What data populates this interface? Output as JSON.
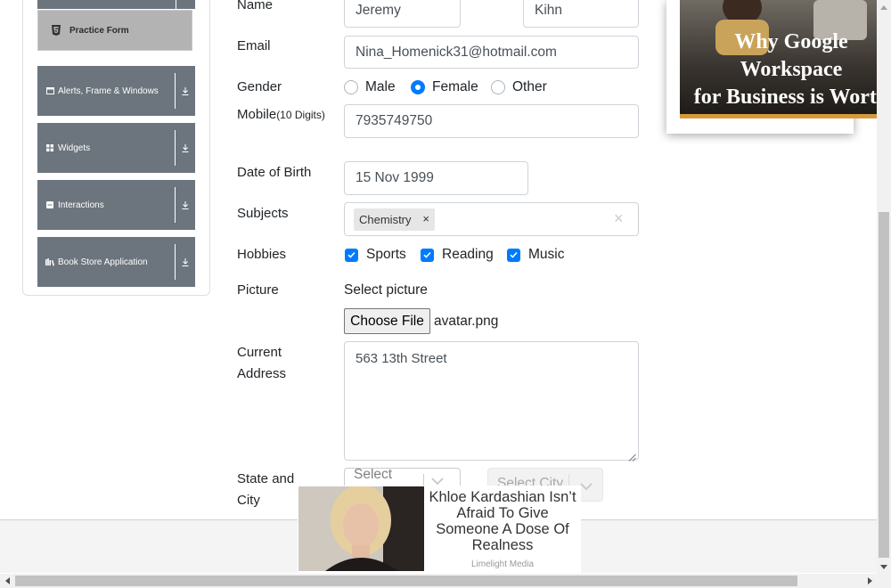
{
  "sidebar": {
    "active_item": {
      "label": "Practice Form",
      "icon": "html5-icon"
    },
    "groups": [
      {
        "label": "Alerts, Frame & Windows",
        "icon": "window-icon"
      },
      {
        "label": "Widgets",
        "icon": "grid-icon"
      },
      {
        "label": "Interactions",
        "icon": "list-icon"
      },
      {
        "label": "Book Store Application",
        "icon": "book-icon"
      }
    ]
  },
  "form": {
    "name_label": "Name",
    "first_name": "Jeremy",
    "last_name": "Kihn",
    "email_label": "Email",
    "email": "Nina_Homenick31@hotmail.com",
    "gender_label": "Gender",
    "gender_options": [
      "Male",
      "Female",
      "Other"
    ],
    "gender_selected": "Female",
    "mobile_label": "Mobile",
    "mobile_hint": "(10 Digits)",
    "mobile": "7935749750",
    "dob_label": "Date of Birth",
    "dob": "15 Nov 1999",
    "subjects_label": "Subjects",
    "subject_chip": "Chemistry",
    "chip_remove": "×",
    "subjects_clear": "×",
    "hobbies_label": "Hobbies",
    "hobbies": [
      "Sports",
      "Reading",
      "Music"
    ],
    "picture_label": "Picture",
    "picture_prompt": "Select picture",
    "choose_file": "Choose File",
    "file_name": "avatar.png",
    "address_label_1": "Current",
    "address_label_2": "Address",
    "address": "563 13th Street",
    "state_city_label_1": "State and",
    "state_city_label_2": "City",
    "state_placeholder": "Select",
    "city_placeholder": "Select City"
  },
  "ads": {
    "right_ad_text": "Why Google Workspace\nfor Business is Worth the\nUpgrade",
    "bottom_ad_title": "Khloe Kardashian Isn’t Afraid To Give Someone A Dose Of Realness",
    "bottom_ad_source": "Limelight Media"
  },
  "colors": {
    "accent": "#007bff",
    "sidebar_group": "#6c757d",
    "active_item": "#b3b3b3",
    "ad_accent": "#d49a3a"
  }
}
